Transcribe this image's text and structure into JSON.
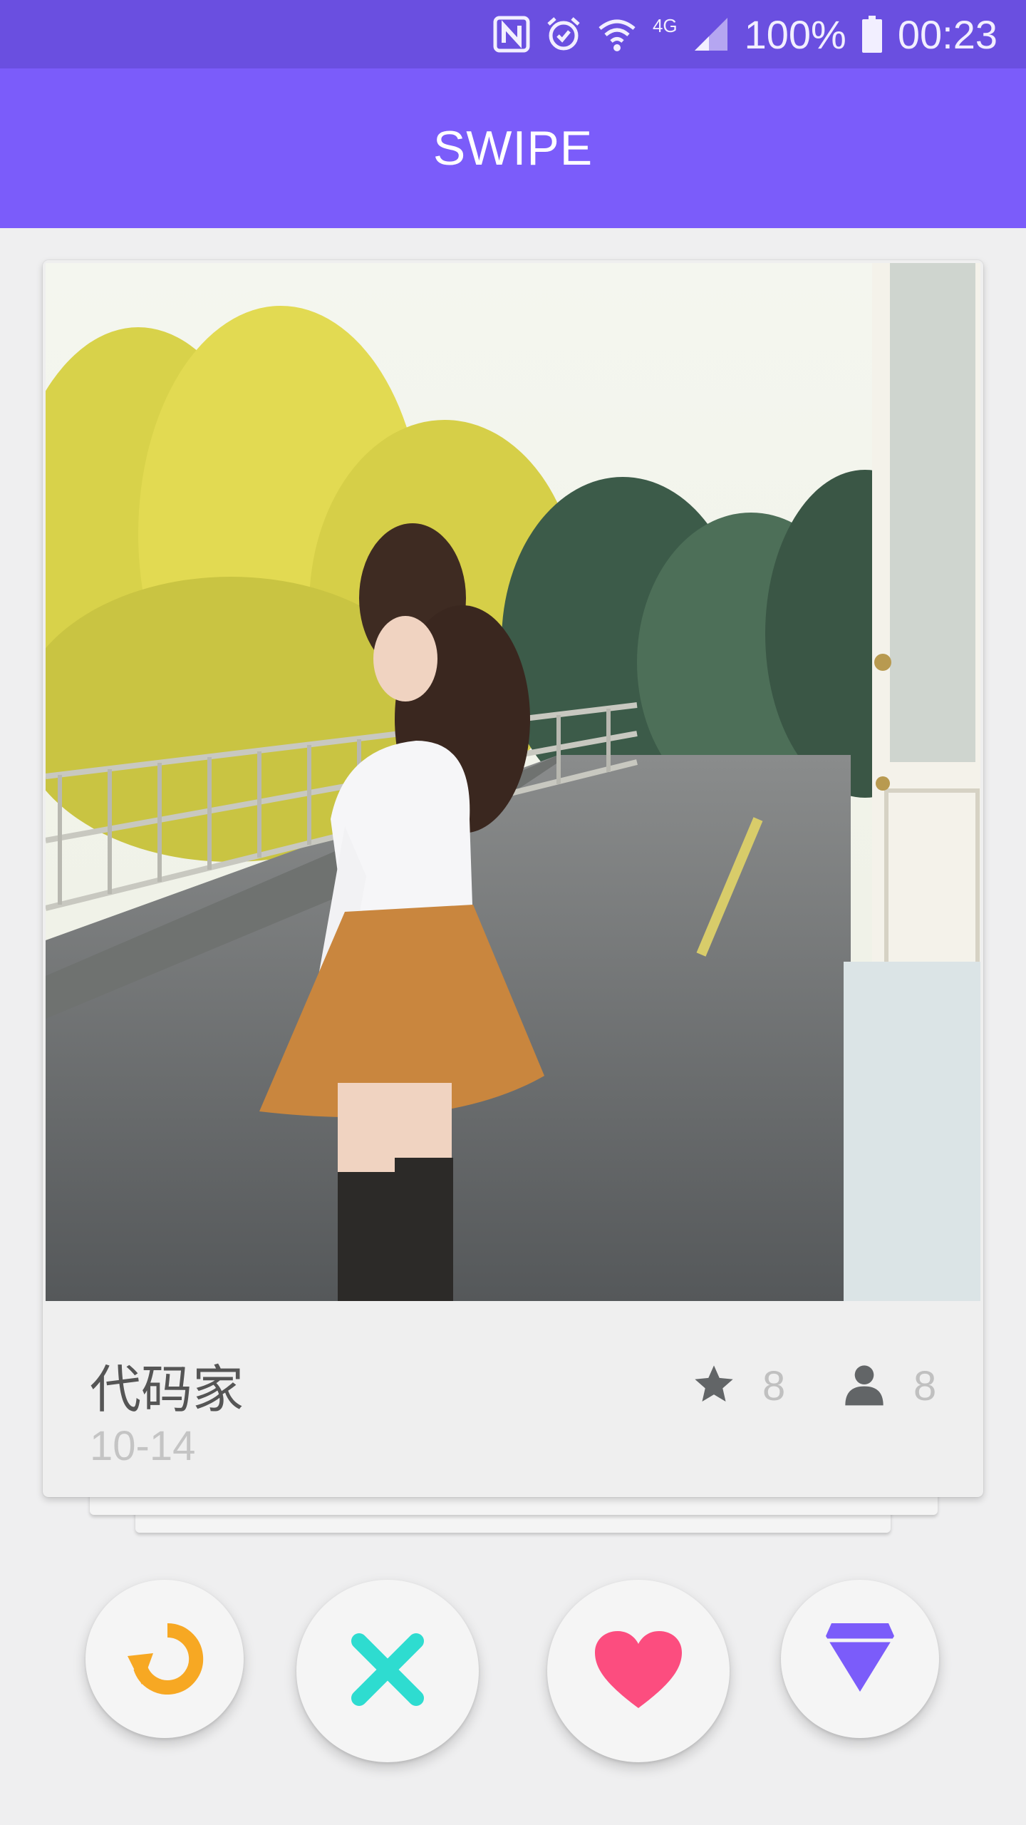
{
  "status_bar": {
    "network": "4G",
    "battery": "100%",
    "time": "00:23",
    "icons": [
      "nfc-icon",
      "alarm-icon",
      "wifi-icon",
      "signal-icon",
      "battery-icon"
    ]
  },
  "app_bar": {
    "title": "SWIPE"
  },
  "card": {
    "name": "代码家",
    "date": "10-14",
    "stars": "8",
    "users": "8",
    "icons": {
      "stars": "star-icon",
      "users": "person-icon"
    }
  },
  "actions": [
    {
      "name": "undo",
      "icon": "undo-icon",
      "color": "#f7a823"
    },
    {
      "name": "nope",
      "icon": "close-icon",
      "color": "#2edcd0"
    },
    {
      "name": "like",
      "icon": "heart-icon",
      "color": "#fc4d7f"
    },
    {
      "name": "super",
      "icon": "diamond-icon",
      "color": "#7b5cfa"
    }
  ],
  "colors": {
    "status_bar": "#6a4fe0",
    "app_bar": "#7b5cfa",
    "background": "#efeff0"
  }
}
